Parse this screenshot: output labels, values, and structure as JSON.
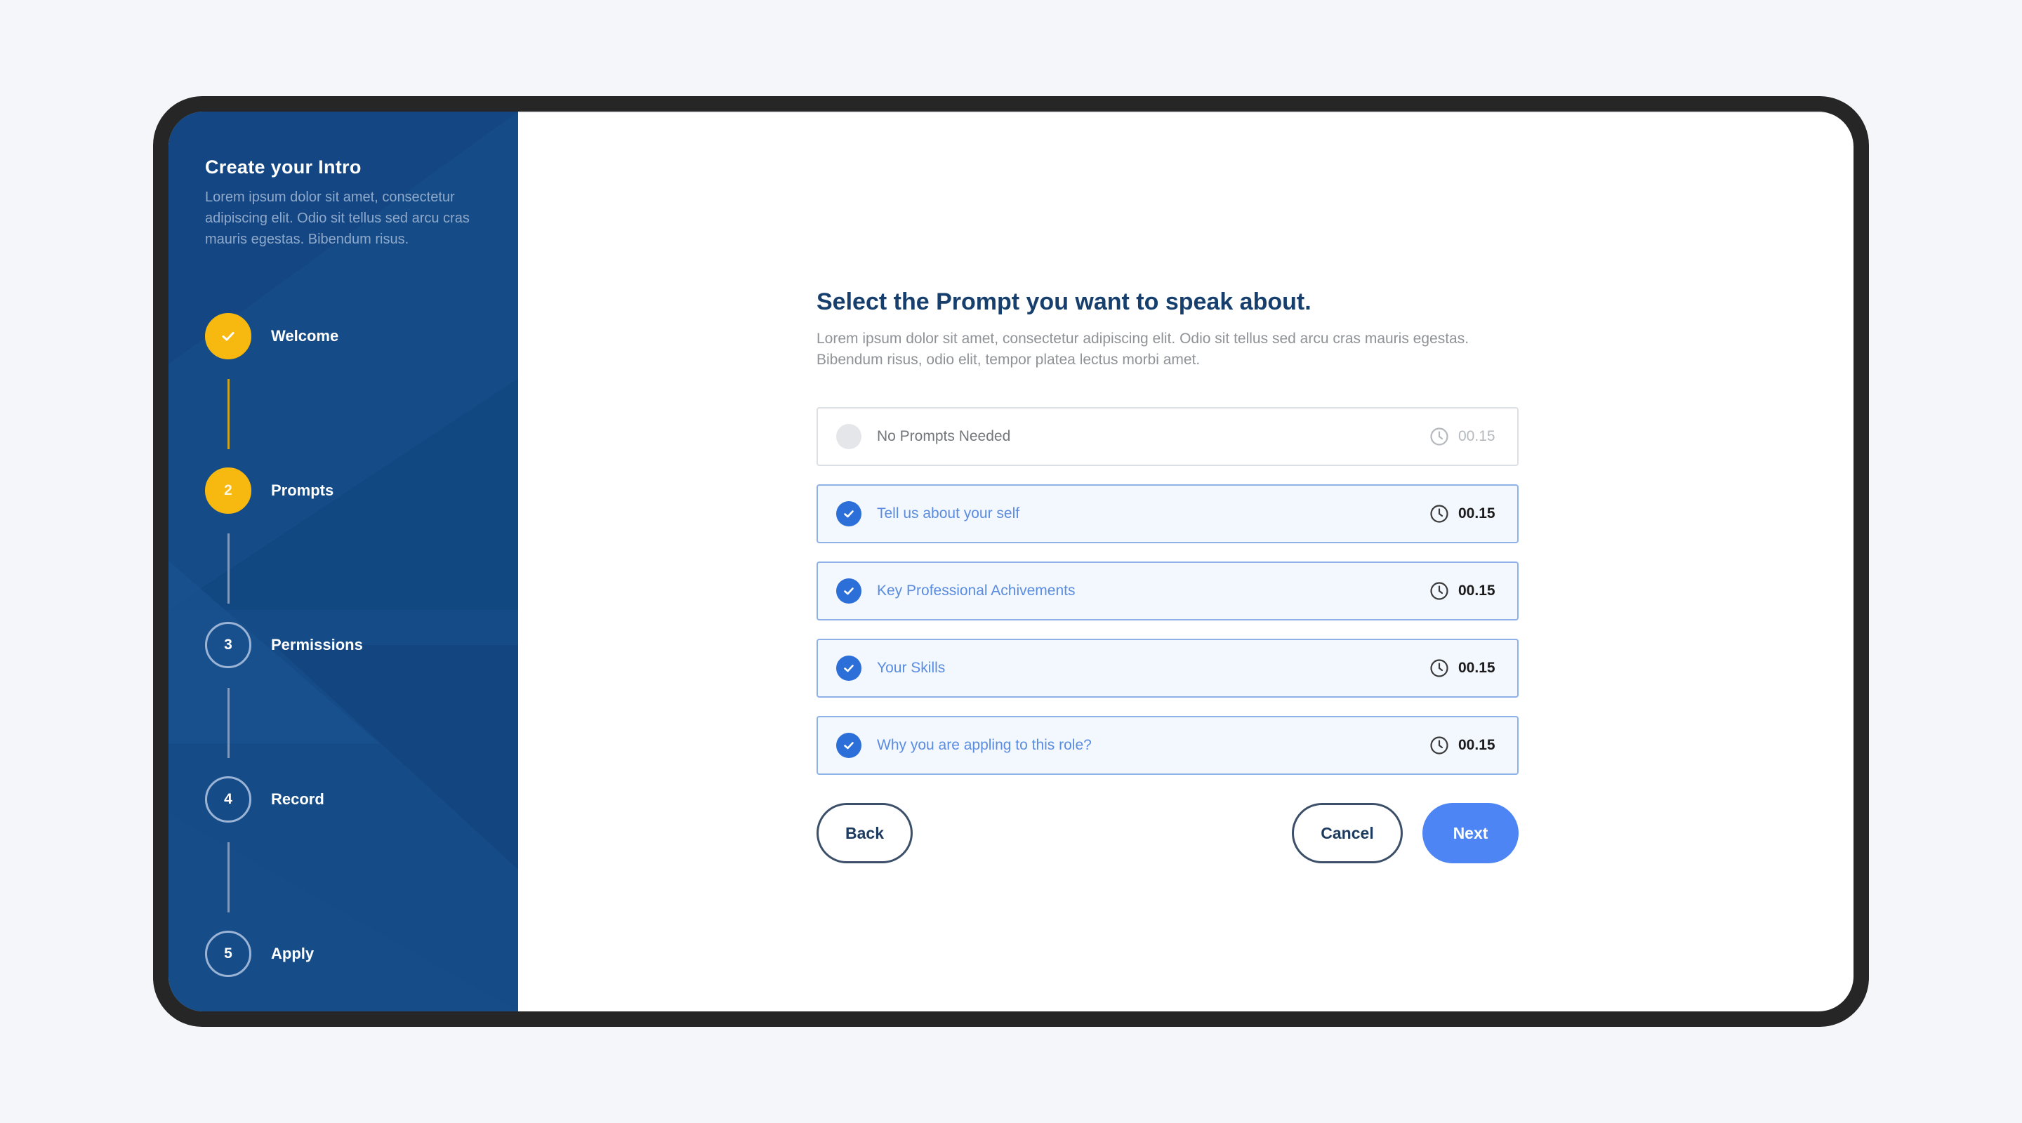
{
  "sidebar": {
    "title": "Create your Intro",
    "description": "Lorem ipsum dolor sit amet, consectetur adipiscing elit. Odio sit tellus sed arcu cras mauris egestas. Bibendum risus.",
    "steps": [
      {
        "number": "1",
        "label": "Welcome",
        "state": "done"
      },
      {
        "number": "2",
        "label": "Prompts",
        "state": "active"
      },
      {
        "number": "3",
        "label": "Permissions",
        "state": "pending"
      },
      {
        "number": "4",
        "label": "Record",
        "state": "pending"
      },
      {
        "number": "5",
        "label": "Apply",
        "state": "pending"
      }
    ]
  },
  "main": {
    "title": "Select the Prompt you want to speak about.",
    "description": "Lorem ipsum dolor sit amet, consectetur adipiscing elit. Odio sit tellus sed arcu cras mauris egestas. Bibendum risus, odio elit, tempor platea lectus morbi amet.",
    "options": [
      {
        "label": "No Prompts Needed",
        "time": "00.15",
        "selected": false
      },
      {
        "label": "Tell us about your self",
        "time": "00.15",
        "selected": true
      },
      {
        "label": "Key Professional Achivements",
        "time": "00.15",
        "selected": true
      },
      {
        "label": "Your Skills",
        "time": "00.15",
        "selected": true
      },
      {
        "label": "Why you are appling to this role?",
        "time": "00.15",
        "selected": true
      }
    ]
  },
  "actions": {
    "back_label": "Back",
    "cancel_label": "Cancel",
    "next_label": "Next"
  },
  "colors": {
    "sidebar_bg": "#154b86",
    "step_active": "#f7b90f",
    "accent": "#4d85f4",
    "check": "#2d6fd8",
    "title": "#163f6d"
  }
}
